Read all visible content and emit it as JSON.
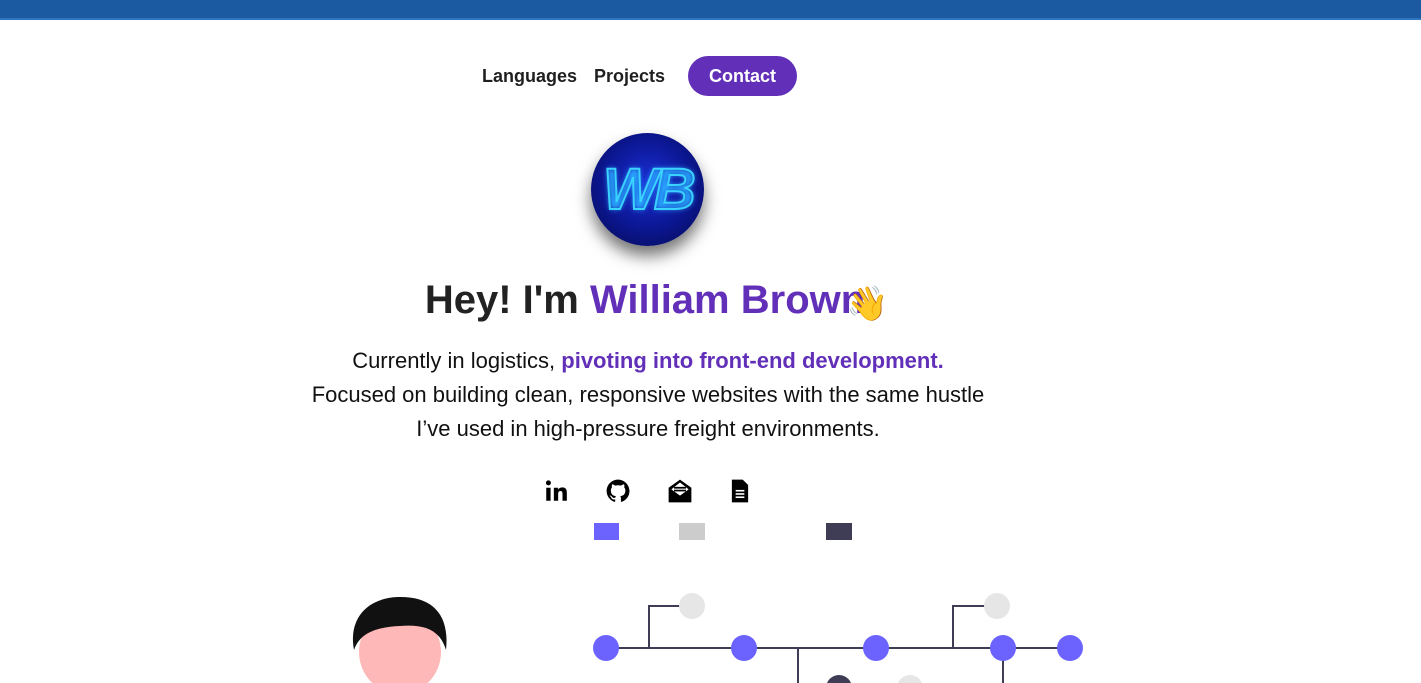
{
  "nav": {
    "languages": "Languages",
    "projects": "Projects",
    "contact": "Contact"
  },
  "logo": {
    "monogram": "WB"
  },
  "hero": {
    "greeting": "Hey! I'm ",
    "name": "William Brown",
    "wave_emoji": "👋",
    "intro_before": "Currently in logistics, ",
    "intro_highlight": "pivoting into front-end development.",
    "intro_after": " Focused on building clean, responsive websites with the same hustle I’ve used in high-pressure freight environments."
  },
  "social_icons": [
    "linkedin-icon",
    "github-icon",
    "mail-icon",
    "resume-document-icon"
  ],
  "colors": {
    "top_bar": "#1b5aa0",
    "accent": "#6230b8",
    "illustration_primary": "#6c63ff",
    "illustration_gray": "#e6e6e6",
    "illustration_dark": "#3f3d56"
  }
}
